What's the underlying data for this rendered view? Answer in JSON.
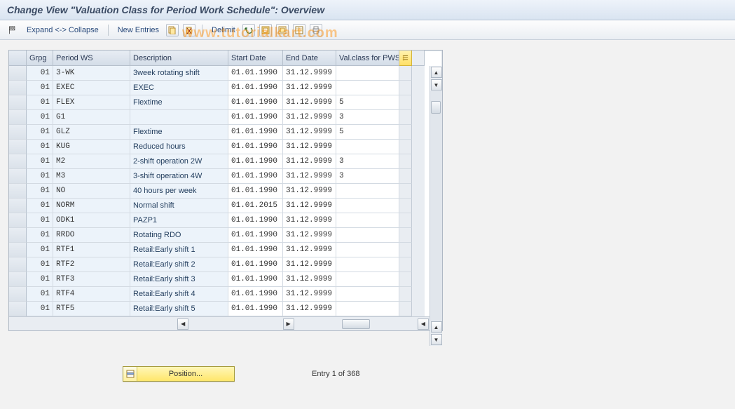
{
  "title": "Change View \"Valuation Class for Period Work Schedule\": Overview",
  "toolbar": {
    "expand_collapse": "Expand <-> Collapse",
    "new_entries": "New Entries",
    "delimit": "Delimit"
  },
  "watermark": "www.tutorialkart.com",
  "columns": {
    "grpg": "Grpg",
    "period_ws": "Period WS",
    "description": "Description",
    "start_date": "Start Date",
    "end_date": "End Date",
    "val_class": "Val.class for PWS"
  },
  "rows": [
    {
      "grpg": "01",
      "pws": "3-WK",
      "desc": "3week rotating shift",
      "start": "01.01.1990",
      "end": "31.12.9999",
      "val": ""
    },
    {
      "grpg": "01",
      "pws": "EXEC",
      "desc": "EXEC",
      "start": "01.01.1990",
      "end": "31.12.9999",
      "val": ""
    },
    {
      "grpg": "01",
      "pws": "FLEX",
      "desc": "Flextime",
      "start": "01.01.1990",
      "end": "31.12.9999",
      "val": "5"
    },
    {
      "grpg": "01",
      "pws": "G1",
      "desc": "",
      "start": "01.01.1990",
      "end": "31.12.9999",
      "val": "3"
    },
    {
      "grpg": "01",
      "pws": "GLZ",
      "desc": "Flextime",
      "start": "01.01.1990",
      "end": "31.12.9999",
      "val": "5"
    },
    {
      "grpg": "01",
      "pws": "KUG",
      "desc": "Reduced hours",
      "start": "01.01.1990",
      "end": "31.12.9999",
      "val": ""
    },
    {
      "grpg": "01",
      "pws": "M2",
      "desc": "2-shift operation 2W",
      "start": "01.01.1990",
      "end": "31.12.9999",
      "val": "3"
    },
    {
      "grpg": "01",
      "pws": "M3",
      "desc": "3-shift operation 4W",
      "start": "01.01.1990",
      "end": "31.12.9999",
      "val": "3"
    },
    {
      "grpg": "01",
      "pws": "NO",
      "desc": "40 hours per week",
      "start": "01.01.1990",
      "end": "31.12.9999",
      "val": ""
    },
    {
      "grpg": "01",
      "pws": "NORM",
      "desc": "Normal shift",
      "start": "01.01.2015",
      "end": "31.12.9999",
      "val": ""
    },
    {
      "grpg": "01",
      "pws": "ODK1",
      "desc": "PAZP1",
      "start": "01.01.1990",
      "end": "31.12.9999",
      "val": ""
    },
    {
      "grpg": "01",
      "pws": "RRDO",
      "desc": "Rotating RDO",
      "start": "01.01.1990",
      "end": "31.12.9999",
      "val": ""
    },
    {
      "grpg": "01",
      "pws": "RTF1",
      "desc": "Retail:Early shift 1",
      "start": "01.01.1990",
      "end": "31.12.9999",
      "val": ""
    },
    {
      "grpg": "01",
      "pws": "RTF2",
      "desc": "Retail:Early shift 2",
      "start": "01.01.1990",
      "end": "31.12.9999",
      "val": ""
    },
    {
      "grpg": "01",
      "pws": "RTF3",
      "desc": "Retail:Early shift 3",
      "start": "01.01.1990",
      "end": "31.12.9999",
      "val": ""
    },
    {
      "grpg": "01",
      "pws": "RTF4",
      "desc": "Retail:Early shift 4",
      "start": "01.01.1990",
      "end": "31.12.9999",
      "val": ""
    },
    {
      "grpg": "01",
      "pws": "RTF5",
      "desc": "Retail:Early shift 5",
      "start": "01.01.1990",
      "end": "31.12.9999",
      "val": ""
    }
  ],
  "footer": {
    "position_label": "Position...",
    "entry_text": "Entry 1 of 368"
  }
}
